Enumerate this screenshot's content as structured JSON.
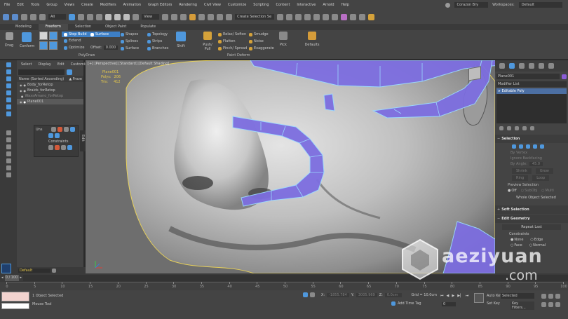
{
  "menu": {
    "items": [
      "File",
      "Edit",
      "Tools",
      "Group",
      "Views",
      "Create",
      "Modifiers",
      "Animation",
      "Graph Editors",
      "Rendering",
      "Civil View",
      "Customize",
      "Scripting",
      "Content",
      "Interactive",
      "Arnold",
      "Help"
    ],
    "user": "Corazon Bry",
    "workspaces_label": "Workspaces:",
    "workspace_value": "Default"
  },
  "toolbar": {
    "filter": "All",
    "view": "View",
    "selection_set": "Create Selection Se"
  },
  "ribbon": {
    "tabs": [
      "Modeling",
      "Freeform",
      "Selection",
      "Object Paint",
      "Populate"
    ],
    "active_tab": "Freeform",
    "panel_left": "PolyDraw",
    "panel_right": "Paint Deform",
    "drag": "Drag",
    "conform": "Conform",
    "step_build": "Step Build",
    "extend": "Extend",
    "optimize": "Optimize",
    "surface": "Surface",
    "offset_label": "Offset:",
    "offset_value": "0.000",
    "col3": [
      "Shapes",
      "Splines",
      "Surface"
    ],
    "col4": [
      "Topology",
      "Strips",
      "Branches"
    ],
    "shift": "Shift",
    "push_pull": "Push/ Pull",
    "col6": [
      "Relax/ Soften",
      "Flatten",
      "Pinch/ Spread"
    ],
    "col7": [
      "Smudge",
      "Noise",
      "Exaggerate"
    ],
    "pick": "Pick",
    "defaults": "Defaults"
  },
  "scene": {
    "tabs": [
      "Select",
      "Display",
      "Edit",
      "Customize"
    ],
    "header_name": "Name (Sorted Ascending)",
    "header_freeze": "▲ Froze",
    "items": [
      "Body_forRetop",
      "Braids_forRetop",
      "WaxsAmano_forRetop",
      "Plane001"
    ]
  },
  "viewport": {
    "label": "[+] [Perspective] [Standard] [Default Shading]",
    "object_name": "Plane001",
    "polys_label": "Polys:",
    "polys_value": "206",
    "tris_label": "Tris:",
    "tris_value": "412"
  },
  "uvs_popup": {
    "title": "Uns",
    "constraints": "Constraints"
  },
  "side_label": "Edit",
  "command_panel": {
    "object_name": "Plane001",
    "modifier_list": "Modifier List",
    "stack_item": "Editable Poly",
    "selection_header": "Selection",
    "by_vertex": "By Vertex",
    "ignore_backfacing": "Ignore Backfacing",
    "by_angle": "By Angle:",
    "angle_value": "45.0",
    "shrink": "Shrink",
    "grow": "Grow",
    "ring": "Ring",
    "loop": "Loop",
    "preview_selection": "Preview Selection",
    "off": "Off",
    "subobj": "SubObj",
    "multi": "Multi",
    "whole_object": "Whole Object Selected",
    "soft_selection": "Soft Selection",
    "edit_geometry": "Edit Geometry",
    "repeat_last": "Repeat Last",
    "constraints": "Constraints",
    "none": "None",
    "edge": "Edge",
    "face": "Face",
    "normal": "Normal"
  },
  "layer": {
    "default": "Default"
  },
  "timeline": {
    "frame": "0 / 100",
    "ticks": [
      "0",
      "5",
      "10",
      "15",
      "20",
      "25",
      "30",
      "35",
      "40",
      "45",
      "50",
      "55",
      "60",
      "65",
      "70",
      "75",
      "80",
      "85",
      "90",
      "95",
      "100"
    ]
  },
  "status": {
    "selected": "1 Object Selected",
    "hint": "Mouse Tool",
    "x_label": "X:",
    "x_value": "-1855.784",
    "y_label": "Y:",
    "y_value": "3005.969",
    "z_label": "Z:",
    "z_value": "0.0cm",
    "grid": "Grid = 10.0cm",
    "add_time_tag": "Add Time Tag",
    "auto_key": "Auto Key",
    "set_key": "Set Key",
    "selected_dd": "Selected",
    "key_filters": "Key Filters...",
    "frame_value": "0"
  },
  "watermark": {
    "brand": "aeziyuan",
    "domain": ".com"
  },
  "colors": {
    "accent": "#3c8fe0",
    "poly_fill": "#7d6ee0",
    "poly_edge": "#9ad8ff",
    "selection_yellow": "#e8d15a"
  }
}
